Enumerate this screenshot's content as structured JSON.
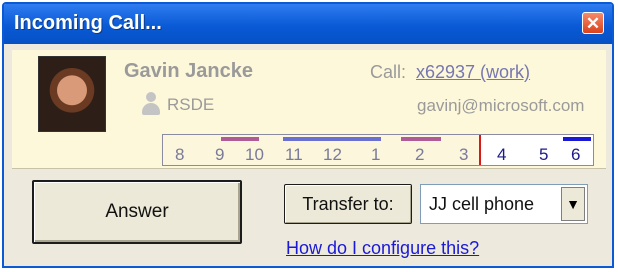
{
  "window": {
    "title": "Incoming Call...",
    "close_icon": "close-icon"
  },
  "caller": {
    "name": "Gavin Jancke",
    "title": "RSDE",
    "call_label": "Call:",
    "call_number": "x62937 (work)",
    "email": "gavinj@microsoft.com",
    "avatar_icon": "caller-photo",
    "presence_icon": "person-icon"
  },
  "timeline": {
    "hours": [
      "8",
      "9",
      "10",
      "11",
      "12",
      "1",
      "2",
      "3",
      "4",
      "5",
      "6"
    ],
    "colors": {
      "tentative": "#b05a96",
      "busy": "#6a70d0",
      "future_busy": "#1a1ad6",
      "now_marker": "#d61a1a"
    }
  },
  "actions": {
    "answer_label": "Answer",
    "transfer_label": "Transfer to:",
    "transfer_selected": "JJ cell phone",
    "dropdown_icon": "chevron-down-icon",
    "config_link": "How do I configure this?"
  }
}
